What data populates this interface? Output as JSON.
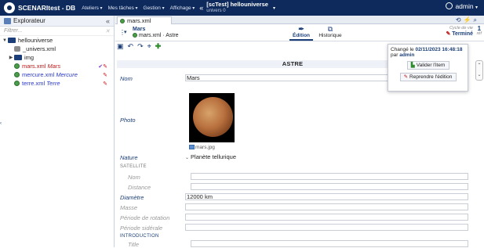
{
  "topbar": {
    "app_name": "SCENARItest - DB",
    "menus": [
      "Ateliers",
      "Mes tâches",
      "Gestion",
      "Affichage"
    ],
    "context_title": "[scTest] hellouniverse",
    "context_sub": "univers 0",
    "user": "admin"
  },
  "explorer": {
    "title": "Explorateur",
    "filter_placeholder": "Filtrer...",
    "tree": [
      {
        "name": "hellouniverse",
        "kind": "folder",
        "open": true,
        "depth": 0
      },
      {
        "name": "_univers.xml",
        "kind": "db",
        "depth": 1
      },
      {
        "name": "img",
        "kind": "folder",
        "open": false,
        "depth": 1
      },
      {
        "file": "mars.xml",
        "title": "Mars",
        "kind": "item",
        "depth": 1,
        "status": "edit"
      },
      {
        "file": "mercure.xml",
        "title": "Mercure",
        "kind": "item",
        "depth": 1,
        "status": "edit"
      },
      {
        "file": "terre.xml",
        "title": "Terre",
        "kind": "item",
        "depth": 1,
        "status": "edit"
      }
    ]
  },
  "main": {
    "tab_label": "mars.xml",
    "breadcrumb_title": "Mars",
    "breadcrumb_path": "mars.xml · Astre",
    "modes": [
      {
        "label": "Édition",
        "active": true
      },
      {
        "label": "Historique",
        "active": false
      }
    ],
    "cycle_label": "Cycle de vie",
    "cycle_value": "Terminé",
    "ref_count": "1",
    "ref_label": "réf"
  },
  "editor": {
    "title": "ASTRE",
    "fields": {
      "nom_label": "Nom",
      "nom_value": "Mars",
      "photo_label": "Photo",
      "photo_caption": "mars.jpg",
      "nature_label": "Nature",
      "nature_value": "Planète tellurique",
      "satellite_section": "SATELLITE",
      "sat_nom_label": "Nom",
      "sat_distance_label": "Distance",
      "diametre_label": "Diamètre",
      "diametre_value": "12000 km",
      "masse_label": "Masse",
      "rotation_label": "Période de rotation",
      "siderale_label": "Période sidérale",
      "intro_section": "INTRODUCTION",
      "intro_title_label": "Title"
    }
  },
  "popup": {
    "changed_prefix": "Changé le",
    "changed_date": "02/11/2023 16:48:18",
    "by_prefix": "par",
    "by_user": "admin",
    "validate_label": "Valider l'item",
    "resume_label": "Reprendre l'édition"
  },
  "colors": {
    "topbar": "#0e2a5c",
    "accent": "#1b3e78",
    "edit_red": "#c01818",
    "ok_green": "#2e8b2e"
  }
}
